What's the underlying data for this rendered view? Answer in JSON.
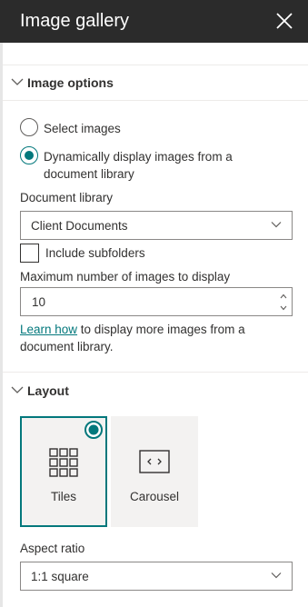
{
  "header": {
    "title": "Image gallery"
  },
  "image_options": {
    "section_title": "Image options",
    "radio_select_label": "Select images",
    "radio_dynamic_label_line1": "Dynamically display images from a",
    "radio_dynamic_label_line2": "document library",
    "selected_radio": "dynamic",
    "document_library_label": "Document library",
    "document_library_value": "Client Documents",
    "include_subfolders_label": "Include subfolders",
    "include_subfolders_checked": false,
    "max_images_label": "Maximum number of images to display",
    "max_images_value": "10",
    "learn_how_link": "Learn how",
    "help_text_rest_line1": " to display more images from a",
    "help_text_line2": "document library."
  },
  "layout": {
    "section_title": "Layout",
    "options": [
      {
        "label": "Tiles",
        "icon": "tiles-grid-icon",
        "selected": true
      },
      {
        "label": "Carousel",
        "icon": "carousel-icon",
        "selected": false
      }
    ],
    "aspect_ratio_label": "Aspect ratio",
    "aspect_ratio_value": "1:1 square"
  },
  "colors": {
    "accent": "#03787c",
    "header_bg": "#2b2b2b"
  }
}
